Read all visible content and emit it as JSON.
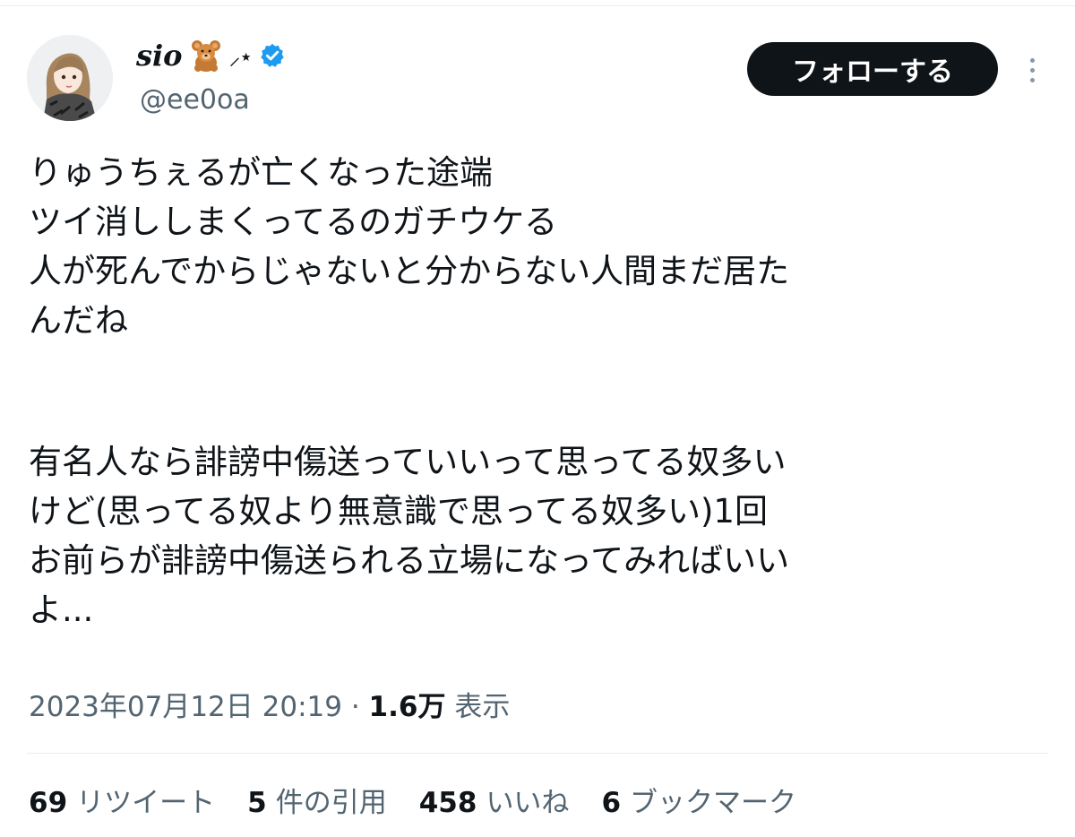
{
  "user": {
    "display_name": "sio",
    "name_emoji": "bear-emoji",
    "name_decoration": "⸝⋆",
    "verified": true,
    "handle": "@ee0oa",
    "avatar": "avatar-illustration"
  },
  "actions": {
    "follow_label": "フォローする",
    "more_icon": "more-vertical-icon"
  },
  "tweet": {
    "lines": [
      "りゅうちぇるが亡くなった途端",
      "ツイ消ししまくってるのガチウケる",
      "人が死んでからじゃないと分からない人間まだ居た",
      "んだね",
      "",
      "有名人なら誹謗中傷送っていいって思ってる奴多い",
      "けど(思ってる奴より無意識で思ってる奴多い)1回",
      "お前らが誹謗中傷送られる立場になってみればいい",
      "よ..."
    ]
  },
  "meta": {
    "timestamp": "2023年07月12日 20:19",
    "separator": " · ",
    "views_count": "1.6万",
    "views_label": "表示"
  },
  "stats": {
    "retweets_count": "69",
    "retweets_label": "リツイート",
    "quotes_count": "5",
    "quotes_label": "件の引用",
    "likes_count": "458",
    "likes_label": "いいね",
    "bookmarks_count": "6",
    "bookmarks_label": "ブックマーク"
  },
  "colors": {
    "text_primary": "#0f1419",
    "text_secondary": "#536471",
    "verified_blue": "#1d9bf0",
    "button_bg": "#0f1419"
  }
}
